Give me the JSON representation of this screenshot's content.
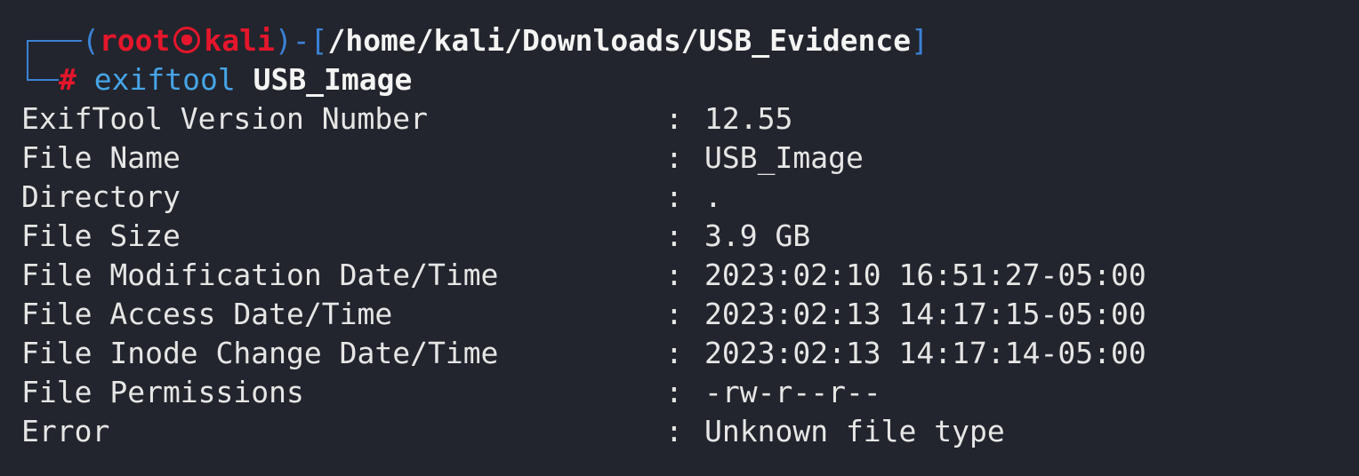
{
  "prompt": {
    "open_paren": "(",
    "user": "root",
    "user_icon": "skull-circle-icon",
    "host": "kali",
    "close_paren_dash": ")-[",
    "path": "/home/kali/Downloads/USB_Evidence",
    "close_bracket": "]",
    "hash": "#",
    "command": "exiftool",
    "argument": "USB_Image"
  },
  "output": [
    {
      "key": "ExifTool Version Number",
      "sep": ":",
      "value": "12.55"
    },
    {
      "key": "File Name",
      "sep": ":",
      "value": "USB_Image"
    },
    {
      "key": "Directory",
      "sep": ":",
      "value": "."
    },
    {
      "key": "File Size",
      "sep": ":",
      "value": "3.9 GB"
    },
    {
      "key": "File Modification Date/Time",
      "sep": ":",
      "value": "2023:02:10 16:51:27-05:00"
    },
    {
      "key": "File Access Date/Time",
      "sep": ":",
      "value": "2023:02:13 14:17:15-05:00"
    },
    {
      "key": "File Inode Change Date/Time",
      "sep": ":",
      "value": "2023:02:13 14:17:14-05:00"
    },
    {
      "key": "File Permissions",
      "sep": ":",
      "value": "-rw-r--r--"
    },
    {
      "key": "Error",
      "sep": ":",
      "value": "Unknown file type"
    }
  ],
  "colors": {
    "background": "#22252d",
    "prompt_frame": "#3b82d6",
    "user_host": "#e5162b",
    "command": "#46a4e8",
    "text": "#e6e6e6"
  }
}
